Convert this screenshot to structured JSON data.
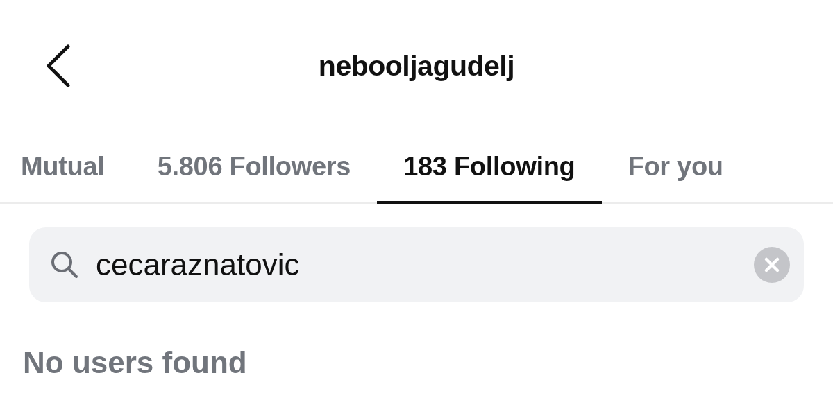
{
  "header": {
    "title": "nebooljagudelj"
  },
  "tabs": [
    {
      "label": "Mutual",
      "selected": false
    },
    {
      "label": "5.806 Followers",
      "selected": false
    },
    {
      "label": "183 Following",
      "selected": true
    },
    {
      "label": "For you",
      "selected": false
    }
  ],
  "search": {
    "value": "cecaraznatovic"
  },
  "message": "No users found"
}
